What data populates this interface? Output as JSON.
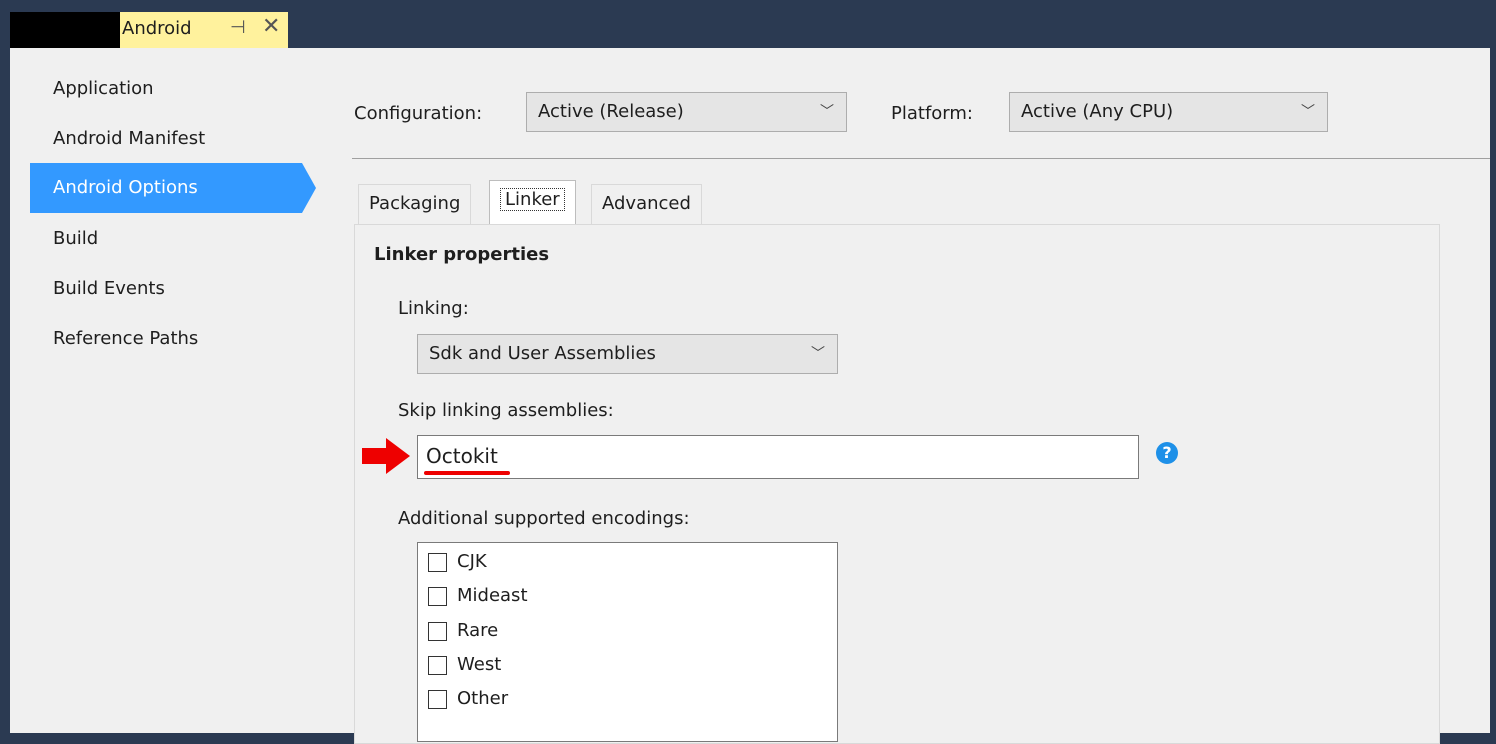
{
  "document_tab": {
    "title": "Android",
    "pin_icon": "pin-icon",
    "close_icon": "close-icon"
  },
  "sidebar": {
    "items": [
      {
        "label": "Application"
      },
      {
        "label": "Android Manifest"
      },
      {
        "label": "Android Options",
        "active": true
      },
      {
        "label": "Build"
      },
      {
        "label": "Build Events"
      },
      {
        "label": "Reference Paths"
      }
    ]
  },
  "toolbar": {
    "configuration_label": "Configuration:",
    "configuration_value": "Active (Release)",
    "platform_label": "Platform:",
    "platform_value": "Active (Any CPU)"
  },
  "tabs": [
    {
      "label": "Packaging"
    },
    {
      "label": "Linker",
      "selected": true
    },
    {
      "label": "Advanced"
    }
  ],
  "linker": {
    "section_title": "Linker properties",
    "linking_label": "Linking:",
    "linking_value": "Sdk and User Assemblies",
    "skip_label": "Skip linking assemblies:",
    "skip_value": "Octokit",
    "encodings_label": "Additional supported encodings:",
    "encodings": [
      {
        "label": "CJK",
        "checked": false
      },
      {
        "label": "Mideast",
        "checked": false
      },
      {
        "label": "Rare",
        "checked": false
      },
      {
        "label": "West",
        "checked": false
      },
      {
        "label": "Other",
        "checked": false
      }
    ]
  },
  "colors": {
    "accent": "#3399ff",
    "titlebar": "#2b3a52",
    "tab": "#fff29d",
    "annotation": "#ee0000",
    "help": "#1e90e8"
  }
}
